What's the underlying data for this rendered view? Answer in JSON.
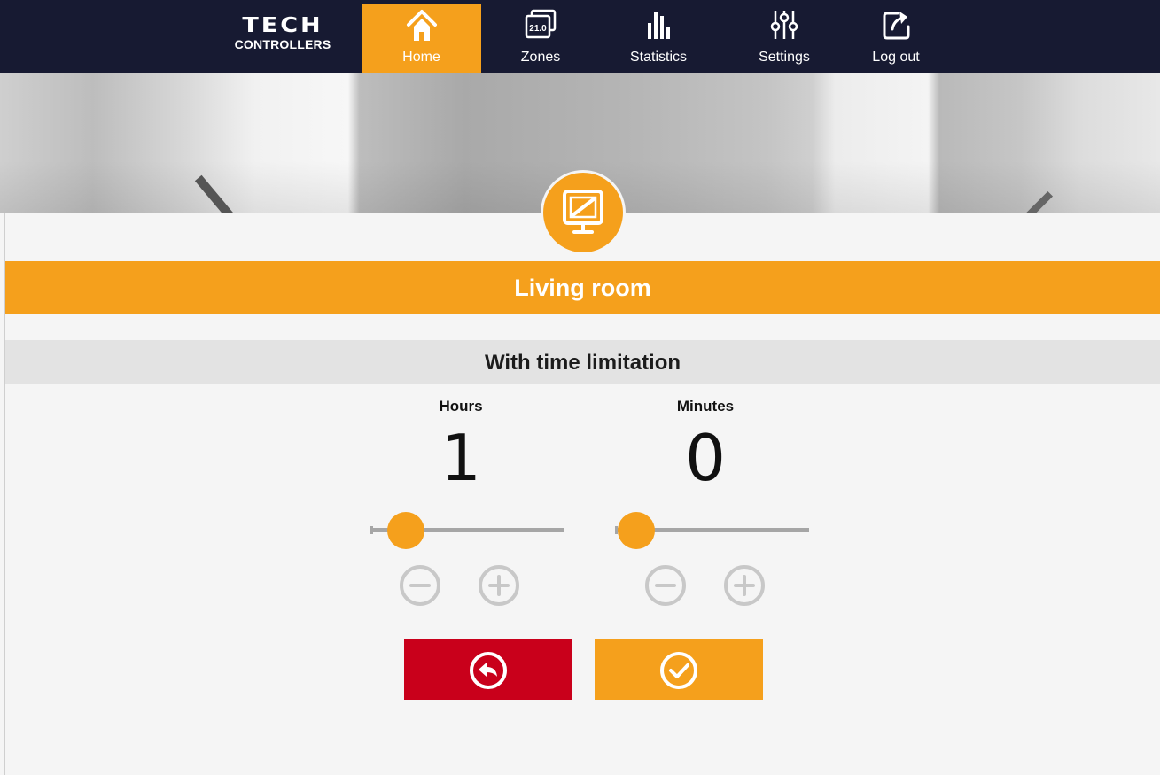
{
  "brand": {
    "logo_word": "TECH",
    "logo_sub": "CONTROLLERS"
  },
  "nav": {
    "items": [
      {
        "label": "Home",
        "icon": "home-icon",
        "active": true
      },
      {
        "label": "Zones",
        "icon": "zones-icon",
        "badge": "21.0",
        "active": false
      },
      {
        "label": "Statistics",
        "icon": "statistics-icon",
        "active": false
      },
      {
        "label": "Settings",
        "icon": "settings-icon",
        "active": false
      },
      {
        "label": "Log out",
        "icon": "logout-icon",
        "active": false
      }
    ]
  },
  "zone": {
    "name": "Living room",
    "icon": "monitor-icon"
  },
  "mode": {
    "title": "With time limitation"
  },
  "hours": {
    "label": "Hours",
    "value": "1",
    "slider_level": 0.05
  },
  "minutes": {
    "label": "Minutes",
    "value": "0",
    "slider_level": 0.0
  },
  "actions": {
    "back": {
      "icon": "undo-icon",
      "color": "#c9001b"
    },
    "confirm": {
      "icon": "check-circle-icon",
      "color": "#f5a01c"
    }
  },
  "colors": {
    "accent": "#f5a01c",
    "nav_background": "#171a32",
    "cancel": "#c9001b",
    "disabled_control": "#c8c8c8"
  }
}
